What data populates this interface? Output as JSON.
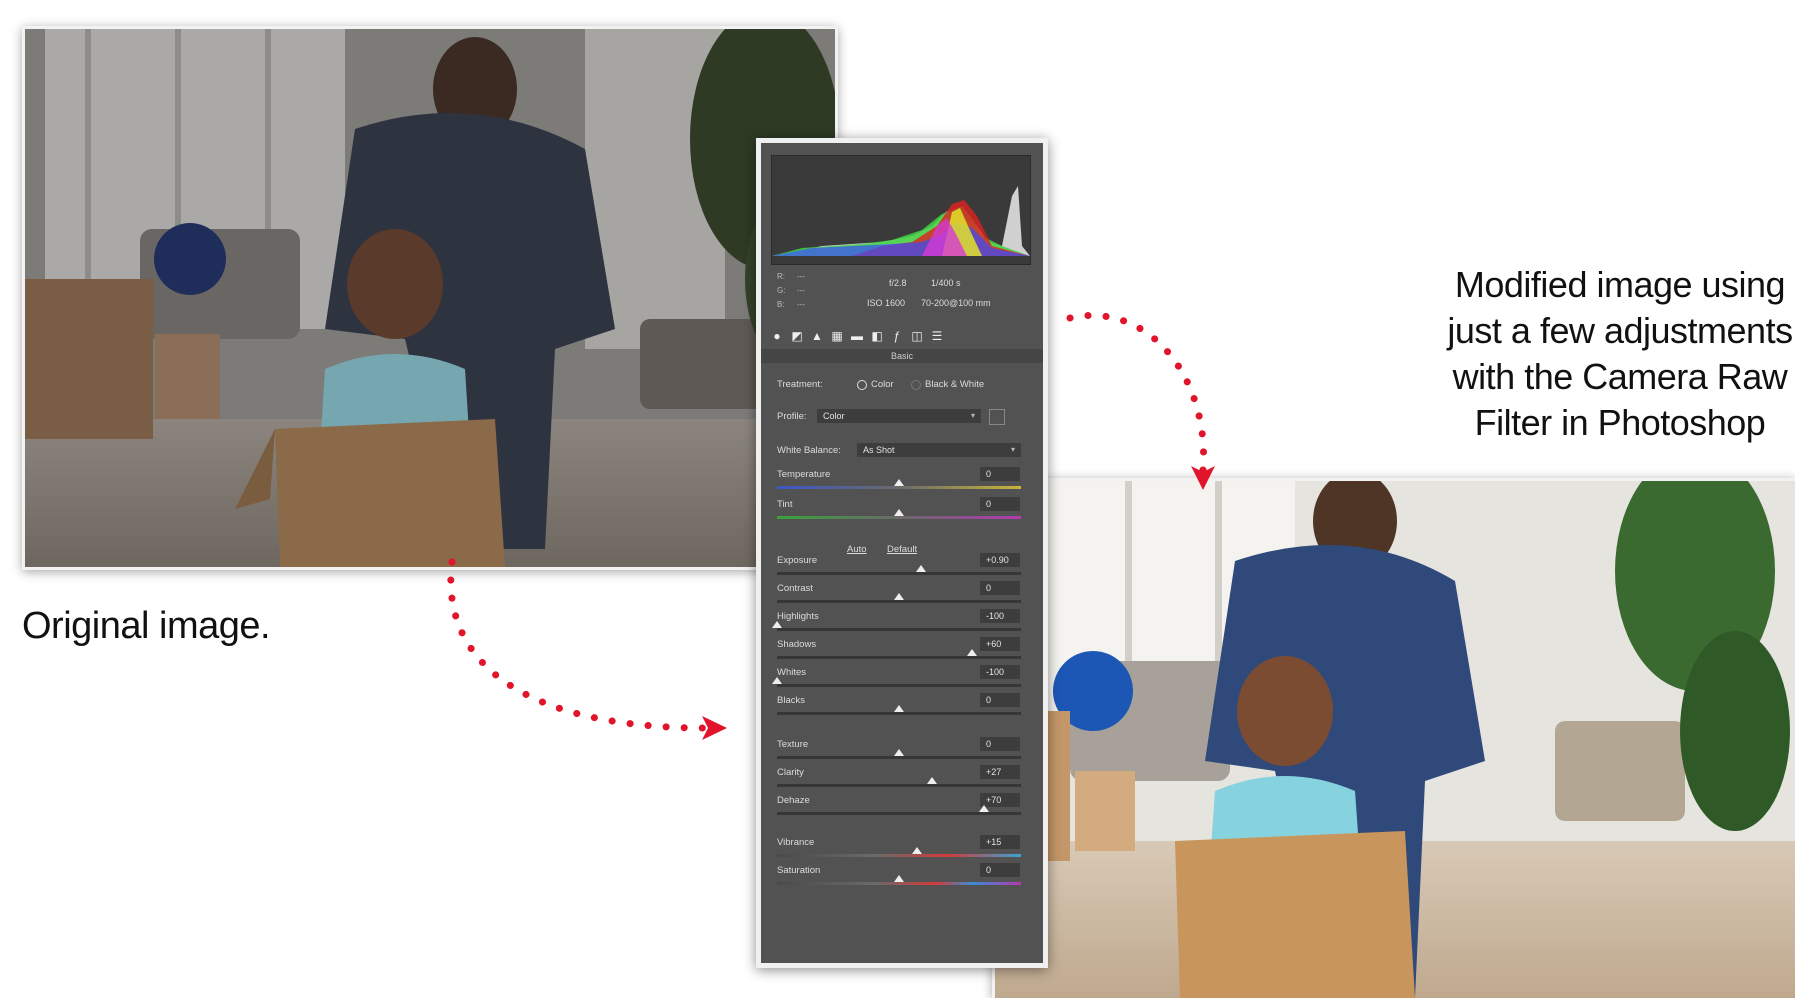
{
  "captions": {
    "original": "Original image.",
    "modified_lines": [
      "Modified image using",
      "just a few adjustments",
      "with the Camera Raw",
      "Filter in Photoshop"
    ]
  },
  "panel": {
    "meta_rgb": [
      "R:",
      "G:",
      "B:"
    ],
    "meta_rgb_values": [
      "---",
      "---",
      "---"
    ],
    "aperture": "f/2.8",
    "shutter": "1/400 s",
    "iso": "ISO 1600",
    "lens": "70-200@100 mm",
    "section_title": "Basic",
    "treatment_label": "Treatment:",
    "treatment_color": "Color",
    "treatment_bw": "Black & White",
    "treatment_selected": "Color",
    "profile_label": "Profile:",
    "profile_value": "Color",
    "white_balance_label": "White Balance:",
    "white_balance_value": "As Shot",
    "auto_label": "Auto",
    "default_label": "Default",
    "sliders": [
      {
        "label": "Temperature",
        "value": "0",
        "level": 0.5,
        "track": "temp"
      },
      {
        "label": "Tint",
        "value": "0",
        "level": 0.5,
        "track": "tint"
      },
      {
        "label": "Exposure",
        "value": "+0.90",
        "level": 0.59,
        "track": "plain"
      },
      {
        "label": "Contrast",
        "value": "0",
        "level": 0.5,
        "track": "plain"
      },
      {
        "label": "Highlights",
        "value": "-100",
        "level": 0.0,
        "track": "plain"
      },
      {
        "label": "Shadows",
        "value": "+60",
        "level": 0.8,
        "track": "plain"
      },
      {
        "label": "Whites",
        "value": "-100",
        "level": 0.0,
        "track": "plain"
      },
      {
        "label": "Blacks",
        "value": "0",
        "level": 0.5,
        "track": "plain"
      },
      {
        "label": "Texture",
        "value": "0",
        "level": 0.5,
        "track": "plain"
      },
      {
        "label": "Clarity",
        "value": "+27",
        "level": 0.635,
        "track": "plain"
      },
      {
        "label": "Dehaze",
        "value": "+70",
        "level": 0.85,
        "track": "plain"
      },
      {
        "label": "Vibrance",
        "value": "+15",
        "level": 0.575,
        "track": "vib"
      },
      {
        "label": "Saturation",
        "value": "0",
        "level": 0.5,
        "track": "sat"
      }
    ]
  },
  "colors": {
    "panel_bg": "#525252",
    "arrow": "#e0142a"
  }
}
